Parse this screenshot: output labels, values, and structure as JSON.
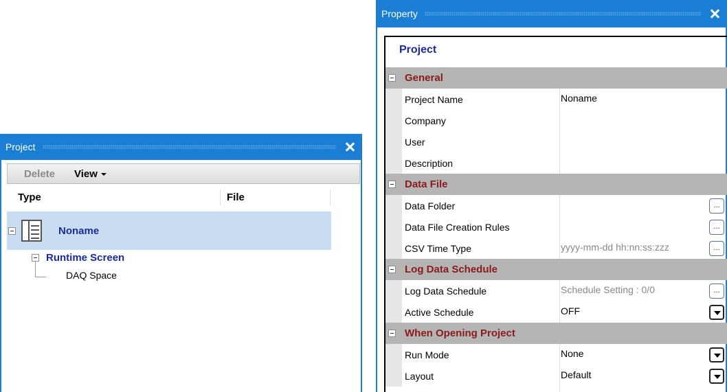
{
  "project_panel": {
    "title": "Project",
    "toolbar": {
      "delete_label": "Delete",
      "view_label": "View"
    },
    "columns": {
      "type": "Type",
      "file": "File"
    },
    "tree": {
      "root": "Noname",
      "child": "Runtime Screen",
      "leaf": "DAQ Space"
    }
  },
  "property_panel": {
    "title": "Property",
    "object_title": "Project",
    "categories": [
      {
        "label": "General",
        "props": [
          {
            "name": "Project Name",
            "value": "Noname"
          },
          {
            "name": "Company",
            "value": ""
          },
          {
            "name": "User",
            "value": ""
          },
          {
            "name": "Description",
            "value": ""
          }
        ]
      },
      {
        "label": "Data File",
        "props": [
          {
            "name": "Data Folder",
            "value": ""
          },
          {
            "name": "Data File Creation Rules",
            "value": ""
          },
          {
            "name": "CSV Time Type",
            "value": "yyyy-mm-dd hh:nn:ss:zzz"
          }
        ]
      },
      {
        "label": "Log Data Schedule",
        "props": [
          {
            "name": "Log Data Schedule",
            "value": "Schedule Setting : 0/0"
          },
          {
            "name": "Active Schedule",
            "value": "OFF"
          }
        ]
      },
      {
        "label": "When Opening Project",
        "props": [
          {
            "name": "Run Mode",
            "value": "None"
          },
          {
            "name": "Layout",
            "value": "Default"
          }
        ]
      }
    ],
    "ellipsis": "..."
  }
}
